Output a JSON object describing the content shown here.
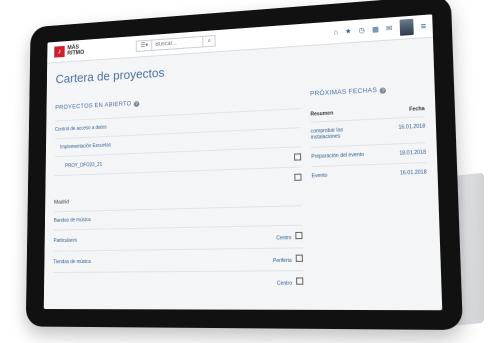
{
  "app": {
    "logo_line1": "MÁS",
    "logo_line2": "RITMO",
    "search_placeholder": "Buscar..."
  },
  "page": {
    "title": "Cartera de proyectos"
  },
  "open_projects": {
    "title": "PROYECTOS EN ABIERTO",
    "rows": [
      {
        "label": "Control de acceso a datos",
        "indent": 0
      },
      {
        "label": "Implementación Escuelas",
        "indent": 1
      },
      {
        "label": "PROY_DFO23_21",
        "indent": 2
      }
    ],
    "group_label": "Madrid",
    "group_rows": [
      {
        "label": "Bandas de música",
        "location": ""
      },
      {
        "label": "Particulares",
        "location": "Centro"
      },
      {
        "label": "Tiendas de música",
        "location": "Periferia"
      },
      {
        "label": "",
        "location": "Centro"
      }
    ]
  },
  "upcoming": {
    "title": "PRÓXIMAS FECHAS",
    "col_summary": "Resumen",
    "col_date": "Fecha",
    "rows": [
      {
        "summary": "comprobar las instalaciones",
        "date": "16.01.2018"
      },
      {
        "summary": "Preparación del evento",
        "date": "18.01.2018"
      },
      {
        "summary": "Evento",
        "date": "16.01.2018"
      }
    ]
  }
}
